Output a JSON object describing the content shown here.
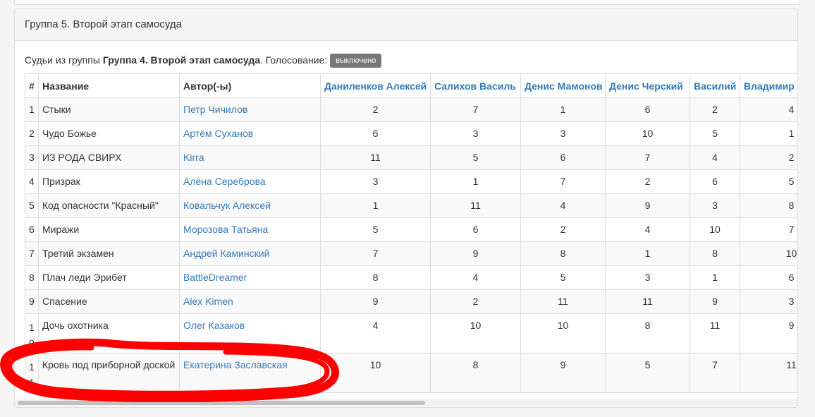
{
  "panel": {
    "title": "Группа 5. Второй этап самосуда",
    "info_prefix": "Судьи из группы",
    "info_group": "Группа 4. Второй этап самосуда",
    "info_voting_label": ". Голосование:",
    "voting_status": "выключено"
  },
  "table": {
    "headers": {
      "num": "#",
      "title": "Название",
      "author": "Автор(-ы)"
    },
    "judges": [
      "Даниленков Алексей",
      "Салихов Василь",
      "Денис Мамонов",
      "Денис Черский",
      "Василий",
      "Владимир С"
    ],
    "rows": [
      {
        "num": "1",
        "title": "Стыки",
        "author": "Петр Чичилов",
        "scores": [
          "2",
          "7",
          "1",
          "6",
          "2",
          "4"
        ]
      },
      {
        "num": "2",
        "title": "Чудо Божье",
        "author": "Артём Суханов",
        "scores": [
          "6",
          "3",
          "3",
          "10",
          "5",
          "1"
        ]
      },
      {
        "num": "3",
        "title": "ИЗ РОДА СВИРХ",
        "author": "Kirra",
        "scores": [
          "11",
          "5",
          "6",
          "7",
          "4",
          "2"
        ]
      },
      {
        "num": "4",
        "title": "Призрак",
        "author": "Алёна Сереброва",
        "scores": [
          "3",
          "1",
          "7",
          "2",
          "6",
          "5"
        ]
      },
      {
        "num": "5",
        "title": "Код опасности \"Красный\"",
        "author": "Ковальчук Алексей",
        "scores": [
          "1",
          "11",
          "4",
          "9",
          "3",
          "8"
        ]
      },
      {
        "num": "6",
        "title": "Миражи",
        "author": "Морозова Татьяна",
        "scores": [
          "5",
          "6",
          "2",
          "4",
          "10",
          "7"
        ]
      },
      {
        "num": "7",
        "title": "Третий экзамен",
        "author": "Андрей Каминский",
        "scores": [
          "7",
          "9",
          "8",
          "1",
          "8",
          "10"
        ]
      },
      {
        "num": "8",
        "title": "Плач леди Эрибет",
        "author": "BattleDreamer",
        "scores": [
          "8",
          "4",
          "5",
          "3",
          "1",
          "6"
        ]
      },
      {
        "num": "9",
        "title": "Спасение",
        "author": "Alex Kimen",
        "scores": [
          "9",
          "2",
          "11",
          "11",
          "9",
          "3"
        ]
      },
      {
        "num": "10",
        "title": "Дочь охотника",
        "author": "Олег Казаков",
        "scores": [
          "4",
          "10",
          "10",
          "8",
          "11",
          "9"
        ]
      },
      {
        "num": "11",
        "title": "Кровь под приборной доской",
        "author": "Екатерина Заславская",
        "scores": [
          "10",
          "8",
          "9",
          "5",
          "7",
          "11"
        ]
      }
    ]
  },
  "annotation": {
    "color": "#ff0000"
  }
}
